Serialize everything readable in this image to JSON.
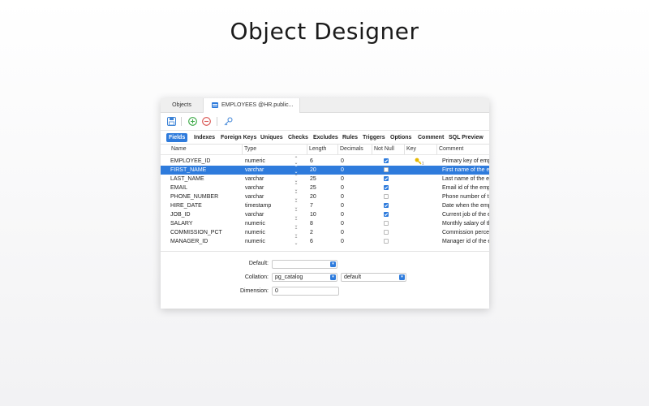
{
  "headline": "Object Designer",
  "tabs": {
    "objects": "Objects",
    "employees": "EMPLOYEES @HR.public..."
  },
  "subtabs": [
    "Fields",
    "Indexes",
    "Foreign Keys",
    "Uniques",
    "Checks",
    "Excludes",
    "Rules",
    "Triggers",
    "Options",
    "Comment",
    "SQL Preview"
  ],
  "grid": {
    "headers": [
      "Name",
      "Type",
      "Length",
      "Decimals",
      "Not Null",
      "Key",
      "Comment"
    ],
    "rows": [
      {
        "name": "EMPLOYEE_ID",
        "type": "numeric",
        "length": "6",
        "decimals": "0",
        "notnull": true,
        "key": true,
        "comment": "Primary key of empl"
      },
      {
        "name": "FIRST_NAME",
        "type": "varchar",
        "length": "20",
        "decimals": "0",
        "notnull": false,
        "key": false,
        "comment": "First name of the em"
      },
      {
        "name": "LAST_NAME",
        "type": "varchar",
        "length": "25",
        "decimals": "0",
        "notnull": true,
        "key": false,
        "comment": "Last name of the em"
      },
      {
        "name": "EMAIL",
        "type": "varchar",
        "length": "25",
        "decimals": "0",
        "notnull": true,
        "key": false,
        "comment": "Email id of the empl"
      },
      {
        "name": "PHONE_NUMBER",
        "type": "varchar",
        "length": "20",
        "decimals": "0",
        "notnull": false,
        "key": false,
        "comment": "Phone number of th"
      },
      {
        "name": "HIRE_DATE",
        "type": "timestamp",
        "length": "7",
        "decimals": "0",
        "notnull": true,
        "key": false,
        "comment": "Date when the empl"
      },
      {
        "name": "JOB_ID",
        "type": "varchar",
        "length": "10",
        "decimals": "0",
        "notnull": true,
        "key": false,
        "comment": "Current job of the e"
      },
      {
        "name": "SALARY",
        "type": "numeric",
        "length": "8",
        "decimals": "0",
        "notnull": false,
        "key": false,
        "comment": "Monthly salary of th"
      },
      {
        "name": "COMMISSION_PCT",
        "type": "numeric",
        "length": "2",
        "decimals": "0",
        "notnull": false,
        "key": false,
        "comment": "Commission percen"
      },
      {
        "name": "MANAGER_ID",
        "type": "numeric",
        "length": "6",
        "decimals": "0",
        "notnull": false,
        "key": false,
        "comment": "Manager id of the e"
      }
    ],
    "selected_row": 1
  },
  "props": {
    "default_label": "Default:",
    "default_value": "",
    "collation_label": "Collation:",
    "collation_schema": "pg_catalog",
    "collation_value": "default",
    "dimension_label": "Dimension:",
    "dimension_value": "0"
  },
  "colors": {
    "accent": "#2e7bdc",
    "key_icon": "#e6b800"
  },
  "icons": [
    "save-icon",
    "add-icon",
    "remove-icon",
    "key-icon",
    "table-icon"
  ]
}
